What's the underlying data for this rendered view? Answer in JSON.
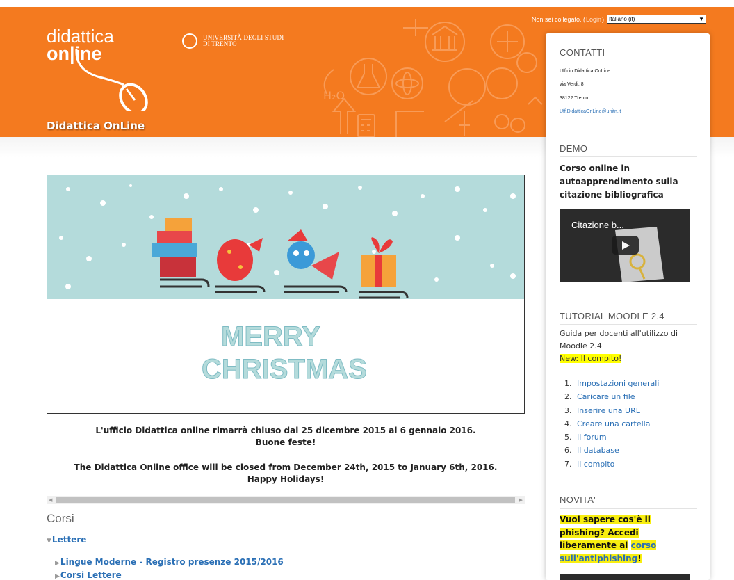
{
  "header": {
    "logo_line1": "didattica",
    "logo_line2": "on|ine",
    "university_line1": "UNIVERSITÀ DEGLI STUDI",
    "university_line2": "DI TRENTO",
    "site_title": "Didattica OnLine",
    "login_text": "Non sei collegato. (",
    "login_link": "Login",
    "login_close": ")",
    "language": "Italiano (it)",
    "colors": {
      "brand_orange": "#f47a1f",
      "link_blue": "#2a6fb5",
      "highlight": "#ffff00"
    }
  },
  "banner": {
    "greeting_line1": "MERRY",
    "greeting_line2": "CHRISTMAS"
  },
  "notice": {
    "it_line1": "L'ufficio Didattica online rimarrà chiuso dal 25 dicembre 2015 al 6 gennaio 2016.",
    "it_line2": "Buone feste!",
    "en_line1": "The Didattica Online office will be closed from December 24th, 2015 to January 6th, 2016.",
    "en_line2": "Happy Holidays!"
  },
  "courses": {
    "title": "Corsi",
    "category": "Lettere",
    "subcategories": [
      "Lingue Moderne - Registro presenze 2015/2016",
      "Corsi Lettere"
    ]
  },
  "sidebar": {
    "contacts": {
      "title": "CONTATTI",
      "lines": [
        "Ufficio Didattica OnLine",
        "via Verdi, 8",
        "38122 Trento"
      ],
      "email": "Uff.DidatticaOnLine@unitn.it"
    },
    "demo": {
      "title": "DEMO",
      "course": "Corso online in autoapprendimento sulla citazione bibliografica",
      "video_title": "Citazione b..."
    },
    "tutorial": {
      "title": "TUTORIAL MOODLE 2.4",
      "description": "Guida per docenti all'utilizzo di Moodle 2.4",
      "new_label": "New: Il compito!",
      "items": [
        {
          "num": "1.",
          "label": "Impostazioni generali"
        },
        {
          "num": "2.",
          "label": "Caricare un file"
        },
        {
          "num": "3.",
          "label": "Inserire una URL"
        },
        {
          "num": "4.",
          "label": "Creare una cartella"
        },
        {
          "num": "5.",
          "label": "Il forum"
        },
        {
          "num": "6.",
          "label": "Il database"
        },
        {
          "num": "7.",
          "label": "Il compito"
        }
      ]
    },
    "news": {
      "title": "NOVITA'",
      "text1": "Vuoi sapere cos'è il phishing? Accedi liberamente al",
      "link": "corso sull'antiphishing",
      "text2": "!"
    }
  }
}
